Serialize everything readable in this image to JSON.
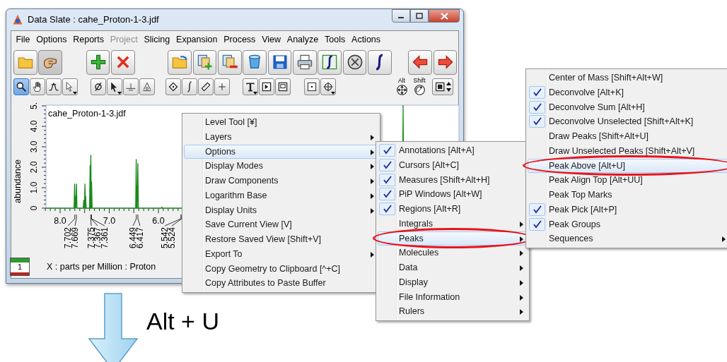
{
  "window": {
    "title": "Data Slate : cahe_Proton-1-3.jdf"
  },
  "menu_bar": [
    {
      "label": "File",
      "disabled": false
    },
    {
      "label": "Options",
      "disabled": false
    },
    {
      "label": "Reports",
      "disabled": false
    },
    {
      "label": "Project",
      "disabled": true
    },
    {
      "label": "Slicing",
      "disabled": false
    },
    {
      "label": "Expansion",
      "disabled": false
    },
    {
      "label": "Process",
      "disabled": false
    },
    {
      "label": "View",
      "disabled": false
    },
    {
      "label": "Analyze",
      "disabled": false
    },
    {
      "label": "Tools",
      "disabled": false
    },
    {
      "label": "Actions",
      "disabled": false
    }
  ],
  "toolbar": {
    "row_1": [
      {
        "selected": false
      },
      {
        "selected": true
      },
      {
        "selected": false
      },
      {
        "selected": false
      },
      {
        "selected": false
      },
      {
        "selected": false
      },
      {
        "selected": false
      },
      {
        "selected": false
      },
      {
        "selected": false
      },
      {
        "selected": false
      },
      {
        "selected": false
      },
      {
        "selected": false
      },
      {
        "selected": false
      },
      {
        "selected": false
      },
      {
        "selected": false
      }
    ],
    "row_2": [
      {
        "selected": true
      },
      {
        "selected": false
      },
      {
        "selected": false
      },
      {
        "selected": false
      },
      {
        "selected": false
      },
      {
        "selected": false
      },
      {
        "selected": false
      },
      {
        "selected": false
      },
      {
        "selected": false
      },
      {
        "selected": false
      },
      {
        "selected": false
      },
      {
        "selected": false
      },
      {
        "selected": false
      },
      {
        "selected": false
      },
      {
        "selected": false
      },
      {
        "selected": false
      },
      {
        "selected": false
      }
    ],
    "modifier_buttons": [
      {
        "label": "Alt"
      },
      {
        "label": "Shift"
      }
    ]
  },
  "plot": {
    "title": "cahe_Proton-1-3.jdf",
    "y_label": "abundance",
    "y_ticks": [
      "0",
      "1.0",
      "2.0",
      "3.0",
      "4.0",
      "5."
    ],
    "x_ticks": [
      "8.0",
      "7.0",
      "6.0"
    ],
    "peak_labels": [
      "7.702",
      "7.669",
      "7.375",
      "7.367",
      "7.361",
      "6.449",
      "6.417",
      "5.542",
      "5.524"
    ],
    "page_indicator": "1",
    "x_axis_label": "X : parts per Million : Proton"
  },
  "context_menu": {
    "items": [
      {
        "label": "Level Tool [¥]",
        "submenu": false,
        "selected": false
      },
      {
        "label": "Layers",
        "submenu": true,
        "selected": false
      },
      {
        "label": "Options",
        "submenu": true,
        "selected": true
      },
      {
        "label": "Display Modes",
        "submenu": true,
        "selected": false
      },
      {
        "label": "Draw Components",
        "submenu": true,
        "selected": false
      },
      {
        "label": "Logarithm Base",
        "submenu": true,
        "selected": false
      },
      {
        "label": "Display Units",
        "submenu": true,
        "selected": false
      },
      {
        "label": "Save Current View [V]",
        "submenu": false,
        "selected": false
      },
      {
        "label": "Restore Saved View [Shift+V]",
        "submenu": false,
        "selected": false
      },
      {
        "label": "Export To",
        "submenu": true,
        "selected": false
      },
      {
        "label": "Copy Geometry to Clipboard [^+C]",
        "submenu": false,
        "selected": false
      },
      {
        "label": "Copy Attributes to Paste Buffer",
        "submenu": false,
        "selected": false
      }
    ]
  },
  "options_submenu": {
    "items": [
      {
        "label": "Annotations [Alt+A]",
        "checked": true,
        "submenu": false,
        "selected": false,
        "circled": false
      },
      {
        "label": "Cursors [Alt+C]",
        "checked": true,
        "submenu": false,
        "selected": false,
        "circled": false
      },
      {
        "label": "Measures [Shift+Alt+H]",
        "checked": true,
        "submenu": false,
        "selected": false,
        "circled": false
      },
      {
        "label": "PiP Windows [Alt+W]",
        "checked": true,
        "submenu": false,
        "selected": false,
        "circled": false
      },
      {
        "label": "Regions [Alt+R]",
        "checked": true,
        "submenu": false,
        "selected": false,
        "circled": false
      },
      {
        "label": "Integrals",
        "checked": false,
        "submenu": true,
        "selected": false,
        "circled": false
      },
      {
        "label": "Peaks",
        "checked": false,
        "submenu": true,
        "selected": true,
        "circled": true
      },
      {
        "label": "Molecules",
        "checked": false,
        "submenu": true,
        "selected": false,
        "circled": false
      },
      {
        "label": "Data",
        "checked": false,
        "submenu": true,
        "selected": false,
        "circled": false
      },
      {
        "label": "Display",
        "checked": false,
        "submenu": true,
        "selected": false,
        "circled": false
      },
      {
        "label": "File Information",
        "checked": false,
        "submenu": true,
        "selected": false,
        "circled": false
      },
      {
        "label": "Rulers",
        "checked": false,
        "submenu": true,
        "selected": false,
        "circled": false
      }
    ]
  },
  "peaks_submenu": {
    "items": [
      {
        "label": "Center of Mass [Shift+Alt+W]",
        "checked": false,
        "submenu": false,
        "selected": false,
        "circled": false
      },
      {
        "label": "Deconvolve [Alt+K]",
        "checked": true,
        "submenu": false,
        "selected": false,
        "circled": false
      },
      {
        "label": "Deconvolve Sum [Alt+H]",
        "checked": true,
        "submenu": false,
        "selected": false,
        "circled": false
      },
      {
        "label": "Deconvolve Unselected [Shift+Alt+K]",
        "checked": true,
        "submenu": false,
        "selected": false,
        "circled": false
      },
      {
        "label": "Draw Peaks [Shift+Alt+U]",
        "checked": false,
        "submenu": false,
        "selected": false,
        "circled": false
      },
      {
        "label": "Draw Unselected Peaks [Shift+Alt+V]",
        "checked": false,
        "submenu": false,
        "selected": false,
        "circled": false
      },
      {
        "label": "Peak Above [Alt+U]",
        "checked": false,
        "submenu": false,
        "selected": true,
        "circled": true
      },
      {
        "label": "Peak Align Top [Alt+UU]",
        "checked": false,
        "submenu": false,
        "selected": false,
        "circled": false
      },
      {
        "label": "Peak Top Marks",
        "checked": false,
        "submenu": false,
        "selected": false,
        "circled": false
      },
      {
        "label": "Peak Pick [Alt+P]",
        "checked": true,
        "submenu": false,
        "selected": false,
        "circled": false
      },
      {
        "label": "Peak Groups",
        "checked": true,
        "submenu": false,
        "selected": false,
        "circled": false
      },
      {
        "label": "Sequences",
        "checked": false,
        "submenu": true,
        "selected": false,
        "circled": false
      }
    ]
  },
  "annotation": {
    "caption": "Alt + U"
  }
}
